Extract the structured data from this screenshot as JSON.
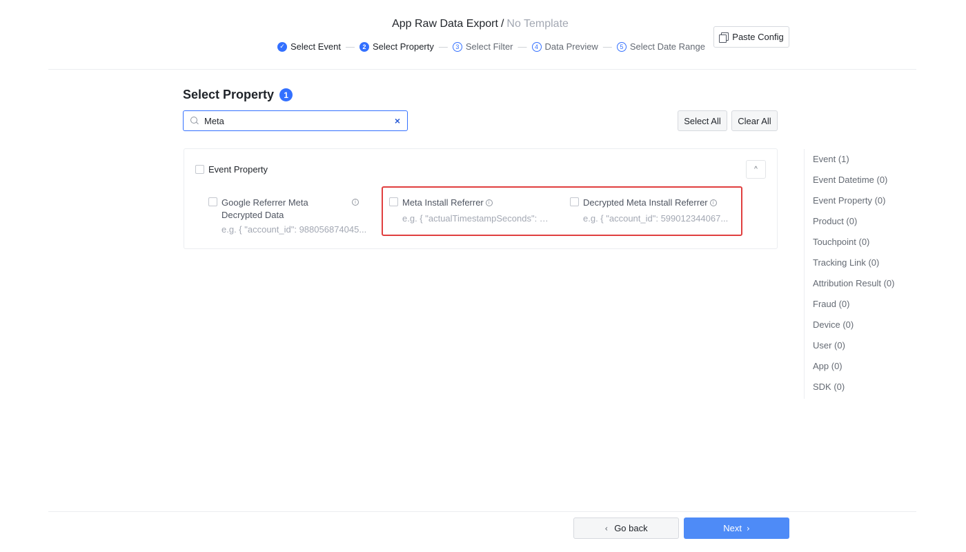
{
  "header": {
    "title": "App Raw Data Export",
    "separator": "/",
    "template": "No Template",
    "paste_config_label": "Paste Config"
  },
  "steps": [
    {
      "num": "✓",
      "label": "Select Event",
      "state": "done"
    },
    {
      "num": "2",
      "label": "Select Property",
      "state": "active"
    },
    {
      "num": "3",
      "label": "Select Filter",
      "state": "pending"
    },
    {
      "num": "4",
      "label": "Data Preview",
      "state": "pending"
    },
    {
      "num": "5",
      "label": "Select Date Range",
      "state": "pending"
    }
  ],
  "section": {
    "title": "Select Property",
    "selected_count": "1"
  },
  "search": {
    "value": "Meta",
    "clear_icon": "×"
  },
  "actions": {
    "select_all": "Select All",
    "clear_all": "Clear All"
  },
  "group": {
    "label": "Event Property",
    "collapse_icon": "^",
    "properties": [
      {
        "name": "Google Referrer Meta Decrypted Data",
        "example": "e.g. { \"account_id\": 988056874045...",
        "checked": false
      },
      {
        "name": "Meta Install Referrer",
        "example": "e.g. { \"actualTimestampSeconds\": 1...",
        "checked": false
      },
      {
        "name": "Decrypted Meta Install Referrer",
        "example": "e.g. { \"account_id\": 599012344067...",
        "checked": false
      }
    ]
  },
  "side_nav": [
    "Event (1)",
    "Event Datetime (0)",
    "Event Property (0)",
    "Product (0)",
    "Touchpoint (0)",
    "Tracking Link (0)",
    "Attribution Result (0)",
    "Fraud (0)",
    "Device (0)",
    "User (0)",
    "App (0)",
    "SDK (0)"
  ],
  "footer": {
    "back_label": "Go back",
    "back_icon": "‹",
    "next_label": "Next",
    "next_icon": "›"
  },
  "colors": {
    "accent": "#3370ff",
    "next_button": "#4e8bf7",
    "highlight_border": "#e03e3e"
  }
}
